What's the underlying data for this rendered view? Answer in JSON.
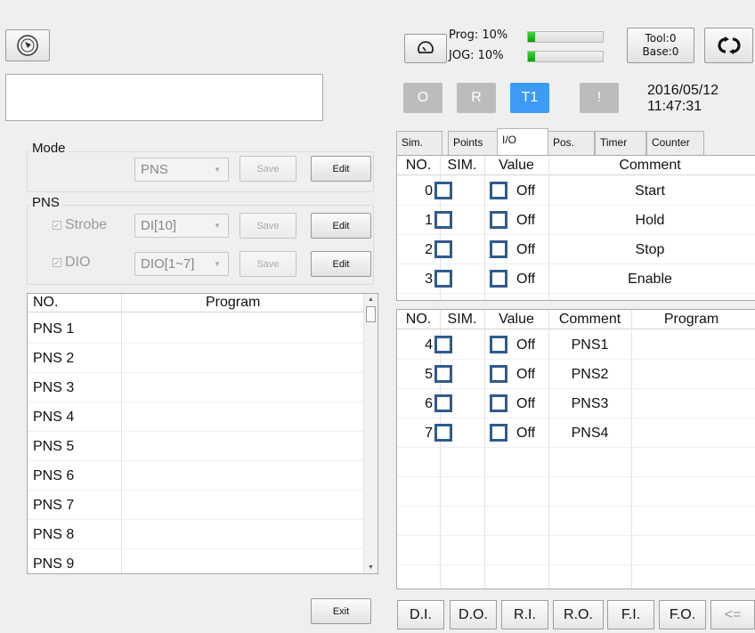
{
  "top_left": {
    "teach_icon": "teach-pendant-icon",
    "message": ""
  },
  "mode": {
    "title": "Mode",
    "value": "PNS",
    "save_label": "Save",
    "edit_label": "Edit"
  },
  "pns": {
    "title": "PNS",
    "strobe_label": "Strobe",
    "strobe_value": "DI[10]",
    "dio_label": "DIO",
    "dio_value": "DIO[1~7]",
    "save_label": "Save",
    "edit_label": "Edit"
  },
  "program_list": {
    "headers": [
      "NO.",
      "Program"
    ],
    "rows": [
      "PNS 1",
      "PNS 2",
      "PNS 3",
      "PNS 4",
      "PNS 5",
      "PNS 6",
      "PNS 7",
      "PNS 8",
      "PNS 9"
    ]
  },
  "exit_label": "Exit",
  "status": {
    "prog_label": "Prog: 10%",
    "prog_value": 0.1,
    "jog_label": "JOG: 10%",
    "jog_value": 0.1,
    "tool": "Tool:0",
    "base": "Base:0",
    "date": "2016/05/12",
    "time": "11:47:31",
    "mode_buttons": [
      "O",
      "R",
      "T1",
      "!"
    ],
    "active_mode": "T1",
    "accent": "#3d9bf5"
  },
  "tabs": [
    "Sim.",
    "Points",
    "I/O",
    "Pos.",
    "Timer",
    "Counter"
  ],
  "active_tab": "I/O",
  "system_io": {
    "headers": [
      "NO.",
      "SIM.",
      "Value",
      "Comment"
    ],
    "rows": [
      {
        "no": "0",
        "value": "Off",
        "comment": "Start"
      },
      {
        "no": "1",
        "value": "Off",
        "comment": "Hold"
      },
      {
        "no": "2",
        "value": "Off",
        "comment": "Stop"
      },
      {
        "no": "3",
        "value": "Off",
        "comment": "Enable"
      }
    ]
  },
  "user_io": {
    "headers": [
      "NO.",
      "SIM.",
      "Value",
      "Comment",
      "Program"
    ],
    "rows": [
      {
        "no": "4",
        "value": "Off",
        "comment": "PNS1",
        "program": ""
      },
      {
        "no": "5",
        "value": "Off",
        "comment": "PNS2",
        "program": ""
      },
      {
        "no": "6",
        "value": "Off",
        "comment": "PNS3",
        "program": ""
      },
      {
        "no": "7",
        "value": "Off",
        "comment": "PNS4",
        "program": ""
      }
    ]
  },
  "io_buttons": [
    "D.I.",
    "D.O.",
    "R.I.",
    "R.O.",
    "F.I.",
    "F.O.",
    "<="
  ]
}
